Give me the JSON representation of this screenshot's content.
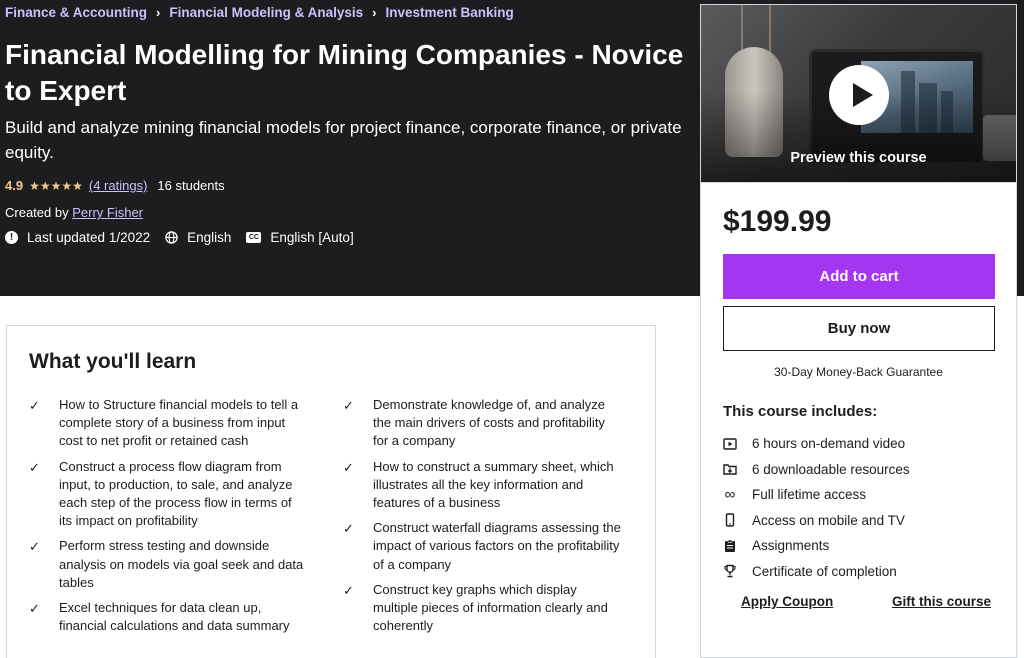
{
  "breadcrumb": [
    "Finance & Accounting",
    "Financial Modeling & Analysis",
    "Investment Banking"
  ],
  "course": {
    "title": "Financial Modelling for Mining Companies - Novice to Expert",
    "subtitle": "Build and analyze mining financial models for project finance, corporate finance, or private equity.",
    "rating": "4.9",
    "stars": 5,
    "ratings_count": "(4 ratings)",
    "students": "16 students",
    "created_by_label": "Created by",
    "instructor": "Perry Fisher",
    "last_updated": "Last updated 1/2022",
    "language": "English",
    "captions": "English [Auto]"
  },
  "sidebar": {
    "preview_label": "Preview this course",
    "price": "$199.99",
    "add_to_cart": "Add to cart",
    "buy_now": "Buy now",
    "guarantee": "30-Day Money-Back Guarantee",
    "includes_title": "This course includes:",
    "includes": [
      {
        "icon": "video-icon",
        "label": "6 hours on-demand video"
      },
      {
        "icon": "download-icon",
        "label": "6 downloadable resources"
      },
      {
        "icon": "infinity-icon",
        "label": "Full lifetime access"
      },
      {
        "icon": "mobile-icon",
        "label": "Access on mobile and TV"
      },
      {
        "icon": "assignment-icon",
        "label": "Assignments"
      },
      {
        "icon": "trophy-icon",
        "label": "Certificate of completion"
      }
    ],
    "apply_coupon": "Apply Coupon",
    "gift_course": "Gift this course"
  },
  "learn": {
    "title": "What you'll learn",
    "left": [
      "How to Structure financial models to tell a complete story of a business from input cost to net profit or retained cash",
      "Construct a process flow diagram from input, to production, to sale, and analyze each step of the process flow in terms of its impact on profitability",
      "Perform stress testing and downside analysis on models via goal seek and data tables",
      "Excel techniques for data clean up, financial calculations and data summary"
    ],
    "right": [
      "Demonstrate knowledge of, and analyze the main drivers of costs and profitability for a company",
      "How to construct a summary sheet, which illustrates all the key information and features of a business",
      "Construct waterfall diagrams assessing the impact of various factors on the profitability of a company",
      "Construct key graphs which display multiple pieces of information clearly and coherently"
    ]
  },
  "colors": {
    "hero_bg": "#1c1d1f",
    "accent_purple": "#a435f0",
    "link_lavender": "#cec0fc",
    "star_gold": "#f3ca8c"
  }
}
